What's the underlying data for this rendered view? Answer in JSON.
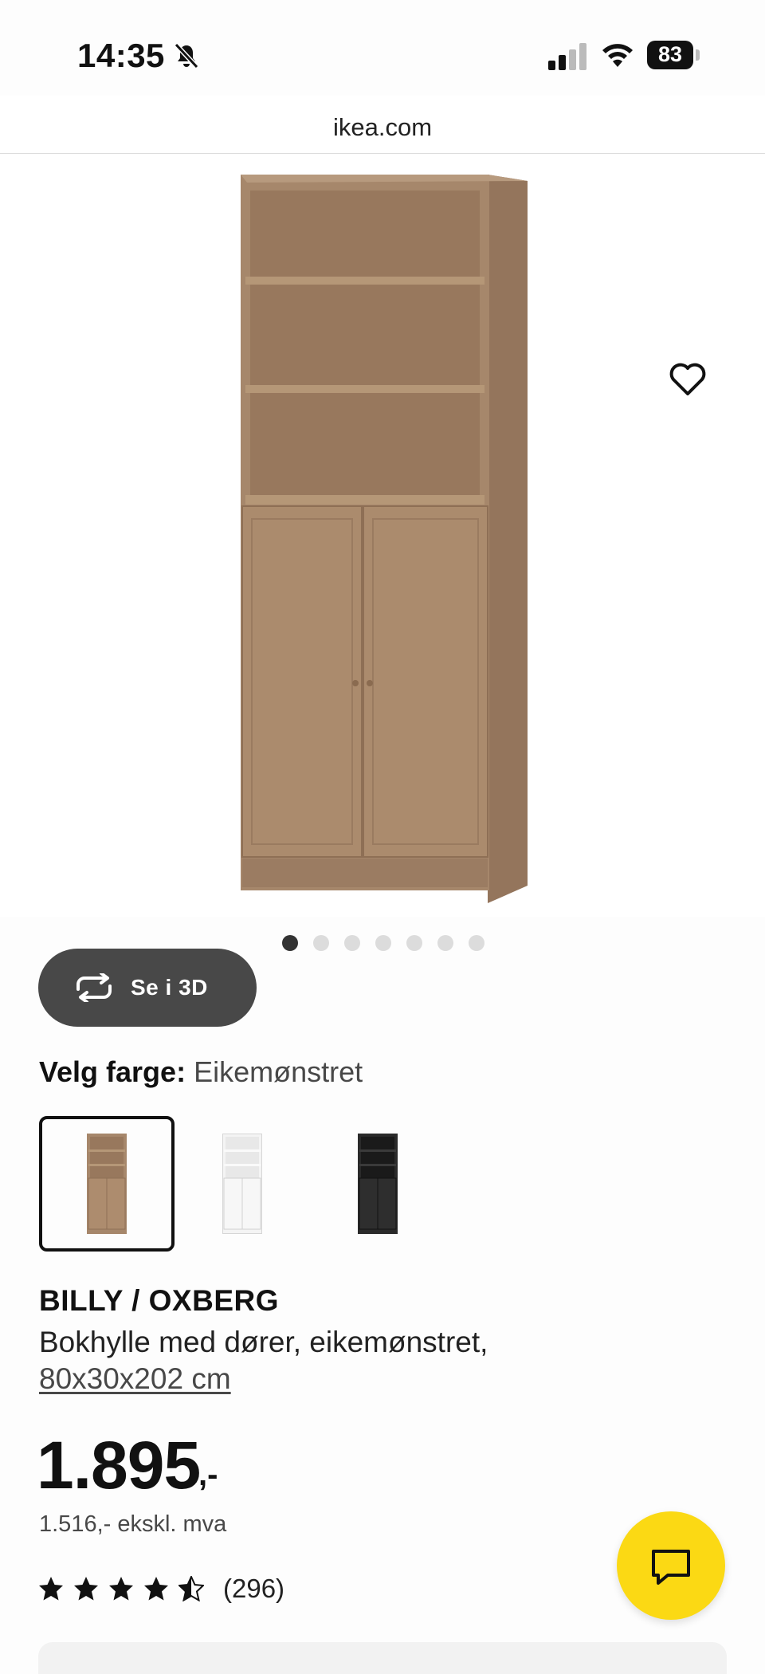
{
  "status_bar": {
    "time": "14:35",
    "battery": "83"
  },
  "browser": {
    "url": "ikea.com"
  },
  "gallery": {
    "view_3d_label": "Se i 3D",
    "image_count": 7,
    "active_index": 0
  },
  "product": {
    "color_label": "Velg farge:",
    "color_value": "Eikemønstret",
    "color_options": [
      "Eikemønstret",
      "Hvit",
      "Svart"
    ],
    "name": "BILLY / OXBERG",
    "description": "Bokhylle med dører, eikemønstret,",
    "size": "80x30x202 cm",
    "price": "1.895",
    "price_suffix": ",-",
    "price_ex_vat": "1.516,- ekskl. mva",
    "rating": 4.5,
    "review_count": "(296)"
  },
  "colors": {
    "chat": "#fbd914",
    "wood": "#a5866a",
    "button_3d": "#484848"
  },
  "icons": [
    "bell-muted-icon",
    "signal-icon",
    "wifi-icon",
    "battery-icon",
    "heart-icon",
    "rotate-3d-icon",
    "star-icon",
    "chat-icon"
  ]
}
